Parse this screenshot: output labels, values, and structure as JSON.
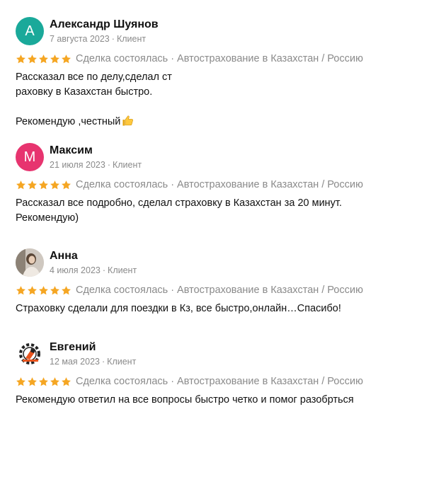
{
  "reviews": [
    {
      "name": "Александр Шуянов",
      "date": "7 августа 2023",
      "role": "Клиент",
      "avatar": {
        "type": "letter",
        "letter": "А",
        "color": "#1aa99a"
      },
      "rating": 5,
      "deal_status": "Сделка состоялась",
      "service": "Автострахование в Казахстан / Россию",
      "text": "Рассказал все по делу,сделал ст\nраховку в Казахстан быстро.\nРекомендую ,честный",
      "emoji": "thumbs-up-icon"
    },
    {
      "name": "Максим",
      "date": "21 июля 2023",
      "role": "Клиент",
      "avatar": {
        "type": "letter",
        "letter": "М",
        "color": "#e7346f"
      },
      "rating": 5,
      "deal_status": "Сделка состоялась",
      "service": "Автострахование в Казахстан / Россию",
      "text": "Рассказал все подробно, сделал страховку в Казахстан за 20 минут.\nРекомендую)"
    },
    {
      "name": "Анна",
      "date": "4 июля 2023",
      "role": "Клиент",
      "avatar": {
        "type": "photo"
      },
      "rating": 5,
      "deal_status": "Сделка состоялась",
      "service": "Автострахование в Казахстан / Россию",
      "text": "Страховку сделали для поездки в Кз, все быстро,онлайн…Спасибо!"
    },
    {
      "name": "Евгений",
      "date": "12 мая 2023",
      "role": "Клиент",
      "avatar": {
        "type": "logo"
      },
      "rating": 5,
      "deal_status": "Сделка состоялась",
      "service": "Автострахование в Казахстан / Россию",
      "text": "Рекомендую ответил на все вопросы быстро четко и помог разобрться"
    }
  ],
  "colors": {
    "star": "#f5a623",
    "muted": "#8a8a8a"
  }
}
